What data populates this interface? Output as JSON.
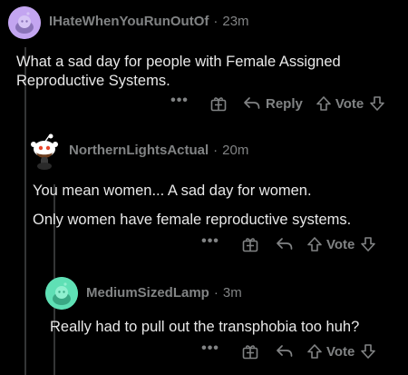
{
  "comments": [
    {
      "username": "IHateWhenYouRunOutOf",
      "separator": "·",
      "age": "23m",
      "lines": [
        "What a sad day for people with Female Assigned",
        "Reproductive Systems."
      ],
      "actions": {
        "more": "•••",
        "reply": "Reply",
        "vote": "Vote"
      },
      "avatar_color": "#c3a5f0"
    },
    {
      "username": "NorthernLightsActual",
      "separator": "·",
      "age": "20m",
      "lines": [
        "You mean women... A sad day for women.",
        "Only women have female reproductive systems."
      ],
      "actions": {
        "more": "•••",
        "vote": "Vote"
      },
      "avatar_color": "#ffffff"
    },
    {
      "username": "MediumSizedLamp",
      "separator": "·",
      "age": "3m",
      "lines": [
        "Really had to pull out the transphobia too huh?"
      ],
      "actions": {
        "more": "•••",
        "vote": "Vote"
      },
      "avatar_color": "#5fe0b5"
    }
  ]
}
